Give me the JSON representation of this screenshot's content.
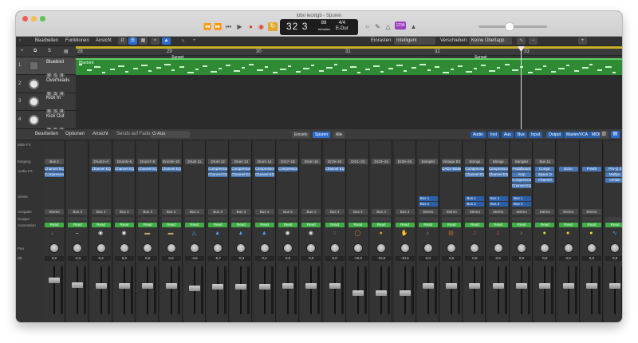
{
  "window": {
    "title": "lobo lecktgb - Spuren"
  },
  "transport": {
    "bar": "32",
    "beat": "3",
    "tempo": "88",
    "tempo_label": "behalten",
    "tempo_sub": "Tempo",
    "signature": "4/4",
    "key": "E-Dur",
    "badge": "1234"
  },
  "toolbar": {
    "edit": "Bearbeiten",
    "functions": "Funktionen",
    "view": "Ansicht",
    "snap_label": "Einrasten:",
    "snap_value": "Intelligent",
    "drag_label": "Verschieben:",
    "drag_value": "Keine Überlapp."
  },
  "ruler": {
    "ticks": [
      "28",
      "29",
      "30",
      "31",
      "32",
      "33"
    ]
  },
  "region": {
    "title": "Bluebird",
    "markers": [
      "Sunset",
      "Sunset"
    ]
  },
  "tracks": [
    {
      "num": "1",
      "name": "Bluebird"
    },
    {
      "num": "2",
      "name": "Overheads"
    },
    {
      "num": "3",
      "name": "Kick In"
    },
    {
      "num": "4",
      "name": "Kick Out"
    }
  ],
  "mixer_bar": {
    "edit": "Bearbeiten",
    "options": "Optionen",
    "view": "Ansicht",
    "sends_label": "Sends auf Fadern:",
    "sends_value": "Aus",
    "single": "Einzeln",
    "tracks": "Spuren",
    "all": "Alle",
    "filters": [
      "Audio",
      "Inst",
      "Aux",
      "Bus",
      "Input",
      "Output",
      "Master/VCA",
      "MIDI"
    ]
  },
  "row_labels": {
    "midi_fx": "MIDI-FX",
    "input": "Eingang",
    "audio_fx": "Audio-FX",
    "sends": "Sends",
    "output": "Ausgabe",
    "group": "Gruppe",
    "automation": "Automation",
    "pan": "Pan",
    "db": "dB"
  },
  "strips": [
    {
      "name": "Bluebird",
      "input": "Bus 4",
      "fx": [
        "Channel EQ",
        "Compressor"
      ],
      "sends": [],
      "output": "Stereo",
      "auto": "Read",
      "db": "0,0",
      "fader": 0.72,
      "icon": "speaker",
      "nc": "green"
    },
    {
      "name": "Overheads",
      "input": "",
      "fx": [],
      "sends": [],
      "output": "Bus 4",
      "auto": "Read",
      "db": "-3,3",
      "fader": 0.62,
      "icon": "cymbal",
      "nc": "green"
    },
    {
      "name": "Kick In",
      "input": "Drum3–4",
      "fx": [
        "Channel EQ"
      ],
      "sends": [],
      "output": "Bus 4",
      "auto": "Read",
      "db": "0,4",
      "fader": 0.6,
      "icon": "drum",
      "nc": "green"
    },
    {
      "name": "Kick Out",
      "input": "Drum5–6",
      "fx": [
        "Channel EQ"
      ],
      "sends": [],
      "output": "Bus 4",
      "auto": "Read",
      "db": "0,0",
      "fader": 0.6,
      "icon": "drum",
      "nc": "green"
    },
    {
      "name": "Snare Top",
      "input": "Drum7–8",
      "fx": [
        "Channel EQ"
      ],
      "sends": [],
      "output": "Bus 4",
      "auto": "Read",
      "db": "0,0",
      "fader": 0.6,
      "icon": "snare",
      "nc": "green"
    },
    {
      "name": "Snare Bottom",
      "input": "Drum9–10",
      "fx": [
        "Channel EQ"
      ],
      "sends": [],
      "output": "Bus 4",
      "auto": "Read",
      "db": "0,0",
      "fader": 0.6,
      "icon": "snare",
      "nc": "green"
    },
    {
      "name": "Hi-Hat",
      "input": "Drum 11",
      "fx": [],
      "sends": [],
      "output": "Bus 4",
      "auto": "Read",
      "db": "-4,5",
      "fader": 0.55,
      "icon": "hihat",
      "nc": "green"
    },
    {
      "name": "Tom High",
      "input": "Drum 12",
      "fx": [
        "Compressor",
        "Channel EQ"
      ],
      "sends": [],
      "output": "Bus 4",
      "auto": "Read",
      "db": "-0,7",
      "fader": 0.58,
      "icon": "tom",
      "nc": "green"
    },
    {
      "name": "Tom Mid",
      "input": "Drum 13",
      "fx": [
        "Compressor",
        "Channel EQ"
      ],
      "sends": [],
      "output": "Bus 4",
      "auto": "Read",
      "db": "-0,3",
      "fader": 0.58,
      "icon": "tom",
      "nc": "green"
    },
    {
      "name": "Tom Low",
      "input": "Drum 14",
      "fx": [
        "Compressor",
        "Channel EQ"
      ],
      "sends": [],
      "output": "Bus 4",
      "auto": "Read",
      "db": "0,2",
      "fader": 0.58,
      "icon": "tom",
      "nc": "green"
    },
    {
      "name": "Room A",
      "input": "Dr17–18",
      "fx": [
        "Compressor"
      ],
      "sends": [],
      "output": "Bus 4",
      "auto": "Read",
      "db": "0,0",
      "fader": 0.6,
      "icon": "room",
      "nc": "green"
    },
    {
      "name": "Room B",
      "input": "Drum 16",
      "fx": [],
      "sends": [],
      "output": "Bus 4",
      "auto": "Read",
      "db": "0,0",
      "fader": 0.6,
      "icon": "room",
      "nc": "green"
    },
    {
      "name": "Leak",
      "input": "Dr19–20",
      "fx": [
        "Channel EQ"
      ],
      "sends": [],
      "output": "Bus 4",
      "auto": "Read",
      "db": "0,0",
      "fader": 0.6,
      "icon": "leak",
      "nc": "green"
    },
    {
      "name": "Tambourine",
      "input": "Dr21–22",
      "fx": [],
      "sends": [],
      "output": "Bus 4",
      "auto": "Read",
      "db": "-10,0",
      "fader": 0.45,
      "icon": "tambourine",
      "nc": "green"
    },
    {
      "name": "Shaker",
      "input": "Dr23–24",
      "fx": [],
      "sends": [],
      "output": "Bus 4",
      "auto": "Read",
      "db": "-10,0",
      "fader": 0.45,
      "icon": "shaker",
      "nc": "green"
    },
    {
      "name": "Hand Claps",
      "input": "Dr25–26",
      "fx": [],
      "sends": [],
      "output": "Bus 4",
      "auto": "Read",
      "db": "-10,0",
      "fader": 0.45,
      "icon": "claps",
      "nc": "green"
    },
    {
      "name": "Liverpool",
      "input": "Sampler",
      "fx": [],
      "sends": [
        "Bus 1",
        "Bus 2"
      ],
      "output": "Stereo",
      "auto": "Read",
      "db": "0,0",
      "fader": 0.6,
      "icon": "guitar",
      "nc": "green"
    },
    {
      "name": "Classi...Organ",
      "input": "Vintage B3",
      "fx": [
        "UADx Water"
      ],
      "sends": [],
      "output": "Stereo",
      "auto": "Read",
      "db": "0,0",
      "fader": 0.6,
      "icon": "organ",
      "nc": "green"
    },
    {
      "name": "Holly...trings",
      "input": "Strings",
      "fx": [
        "Compressor",
        "Channel EQ"
      ],
      "sends": [
        "Bus 1",
        "Bus 2"
      ],
      "output": "Stereo",
      "auto": "Read",
      "db": "0,0",
      "fader": 0.6,
      "icon": "strings",
      "nc": "green"
    },
    {
      "name": "Holly...trings",
      "input": "Strings",
      "fx": [
        "Compressor",
        "Channel EQ"
      ],
      "sends": [
        "Bus 1",
        "Bus 2"
      ],
      "output": "Stereo",
      "auto": "Read",
      "db": "0,0",
      "fader": 0.6,
      "icon": "strings",
      "nc": "green"
    },
    {
      "name": "Classic Clean",
      "input": "Sampler",
      "fx": [
        "Pedalboard",
        "Amp",
        "Compressor",
        "Channel EQ"
      ],
      "sends": [
        "Bus 1",
        "Bus 2"
      ],
      "output": "Stereo",
      "auto": "Read",
      "db": "0,0",
      "fader": 0.6,
      "icon": "guitar",
      "nc": "green"
    },
    {
      "name": "Large...ll One",
      "input": "Bus 11",
      "fx": [
        "Compr.",
        "Space D",
        "Channel"
      ],
      "sends": [],
      "output": "Stereo",
      "auto": "Read",
      "db": "0,0",
      "fader": 0.6,
      "icon": "reverb",
      "nc": "yellow"
    },
    {
      "name": "Echo",
      "input": "",
      "fx": [
        "Echo"
      ],
      "sends": [],
      "output": "Stereo",
      "auto": "Read",
      "db": "0,0",
      "fader": 0.6,
      "icon": "echo",
      "nc": "yellow"
    },
    {
      "name": "Reverb",
      "input": "",
      "fx": [
        "PVerb"
      ],
      "sends": [],
      "output": "Stereo",
      "auto": "Read",
      "db": "0,0",
      "fader": 0.6,
      "icon": "reverb",
      "nc": "yellow"
    },
    {
      "name": "Stereo Out",
      "input": "",
      "fx": [
        "Pro-Q 3",
        "Multipr.",
        "Limiter"
      ],
      "sends": [],
      "output": "",
      "auto": "Read",
      "db": "0,0",
      "fader": 0.6,
      "icon": "output",
      "nc": "blue"
    }
  ]
}
